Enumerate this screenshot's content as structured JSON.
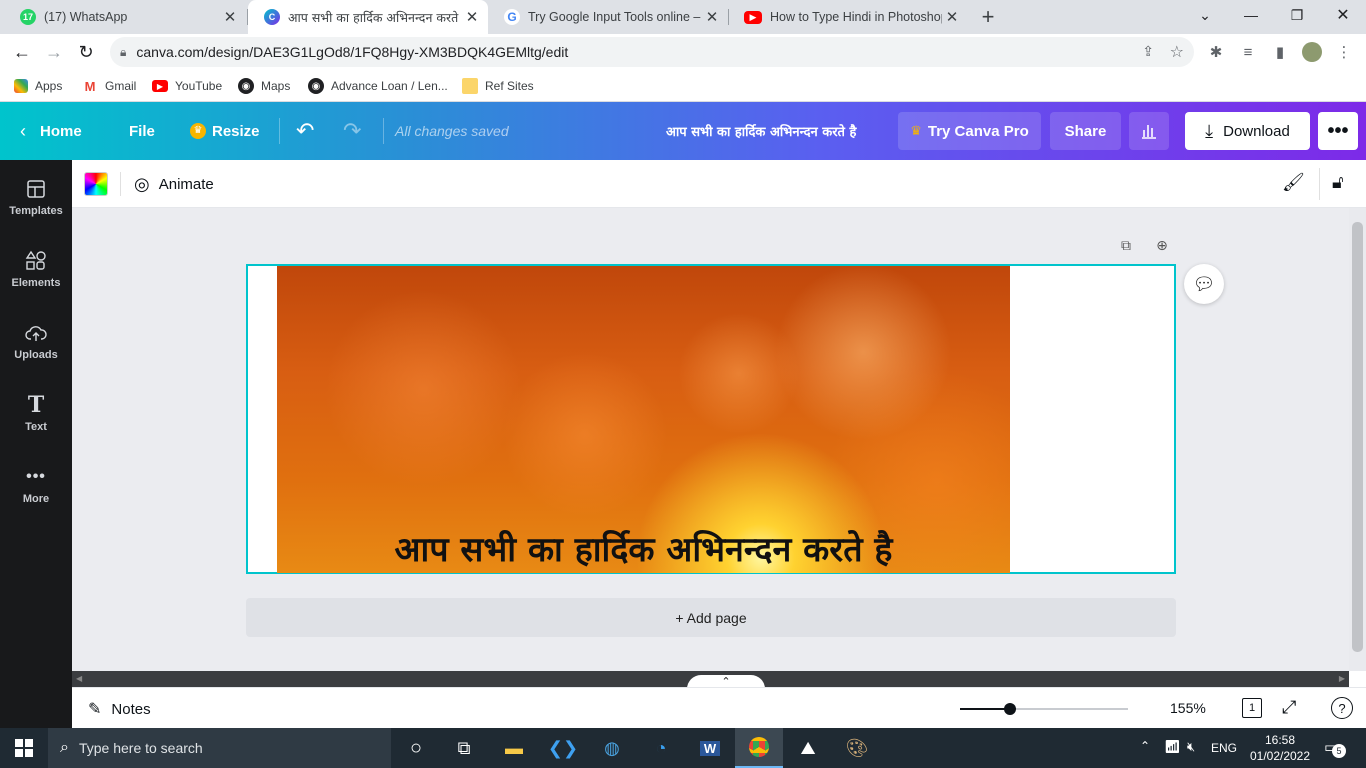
{
  "browser": {
    "tabs": [
      {
        "title": "(17) WhatsApp",
        "favicon": "whatsapp-icon",
        "badge": "17",
        "active": false
      },
      {
        "title": "आप सभी का हार्दिक अभिनन्दन करते",
        "favicon": "canva-icon",
        "badge": "C",
        "active": true
      },
      {
        "title": "Try Google Input Tools online – G",
        "favicon": "google-icon",
        "badge": "G",
        "active": false
      },
      {
        "title": "How to Type Hindi in Photoshop",
        "favicon": "youtube-icon",
        "badge": "",
        "active": false
      }
    ],
    "new_tab_label": "+",
    "url": "canva.com/design/DAE3G1LgOd8/1FQ8Hgy-XM3BDQK4GEMltg/edit",
    "bookmarks": [
      {
        "label": "Apps",
        "icon": "apps-grid-icon"
      },
      {
        "label": "Gmail",
        "icon": "gmail-icon"
      },
      {
        "label": "YouTube",
        "icon": "youtube-icon"
      },
      {
        "label": "Maps",
        "icon": "maps-icon"
      },
      {
        "label": "Advance Loan / Len...",
        "icon": "globe-icon"
      },
      {
        "label": "Ref Sites",
        "icon": "folder-icon"
      }
    ]
  },
  "canva": {
    "header": {
      "home": "Home",
      "file": "File",
      "resize": "Resize",
      "save_status": "All changes saved",
      "design_title": "आप सभी का हार्दिक अभिनन्दन करते है",
      "try_pro": "Try Canva Pro",
      "share": "Share",
      "download": "Download"
    },
    "sidebar": [
      {
        "label": "Templates",
        "icon": "templates-icon"
      },
      {
        "label": "Elements",
        "icon": "elements-icon"
      },
      {
        "label": "Uploads",
        "icon": "uploads-icon"
      },
      {
        "label": "Text",
        "icon": "text-icon"
      },
      {
        "label": "More",
        "icon": "more-dots-icon"
      }
    ],
    "editbar": {
      "animate": "Animate"
    },
    "canvas": {
      "text": "आप सभी का हार्दिक अभिनन्दन करते है",
      "add_page": "+ Add page"
    },
    "footer": {
      "notes": "Notes",
      "zoom": "155%",
      "zoom_level": 0.3,
      "page_count": "1",
      "help": "?"
    }
  },
  "taskbar": {
    "search_placeholder": "Type here to search",
    "language": "ENG",
    "time": "16:58",
    "date": "01/02/2022",
    "notification_count": "5"
  },
  "colors": {
    "canva_teal": "#00c4cc",
    "canva_purple": "#7d2ae8",
    "sidebar_bg": "#18191b",
    "taskbar_bg": "#1f2a33"
  }
}
